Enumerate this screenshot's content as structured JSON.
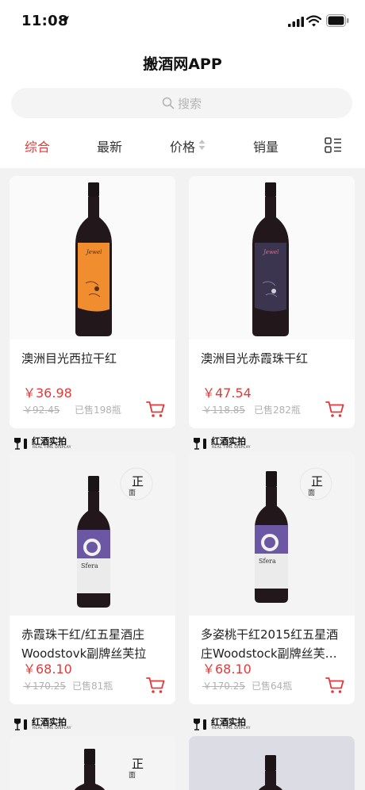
{
  "status": {
    "time": "11:08"
  },
  "header": {
    "title": "搬酒网APP"
  },
  "search": {
    "placeholder": "搜索"
  },
  "sort_tabs": [
    "综合",
    "最新",
    "价格",
    "销量"
  ],
  "products": [
    {
      "name": "澳洲目光西拉干红",
      "price": "￥36.98",
      "original_price": "￥92.45",
      "sold": "已售198瓶",
      "label_color": "#ef8d2f"
    },
    {
      "name": "澳洲目光赤霞珠干红",
      "price": "￥47.54",
      "original_price": "￥118.85",
      "sold": "已售282瓶",
      "label_color": "#3c3550"
    },
    {
      "name": "赤霞珠干红/红五星酒庄Woodstovk副牌丝芙拉赤…",
      "price": "￥68.10",
      "original_price": "￥170.25",
      "sold": "已售81瓶",
      "label_color": "#6b57a3"
    },
    {
      "name": "多姿桃干红2015红五星酒庄Woodstock副牌丝芙…",
      "price": "￥68.10",
      "original_price": "￥170.25",
      "sold": "已售64瓶",
      "label_color": "#6b57a3"
    }
  ],
  "badge": {
    "label": "红酒实拍",
    "sub": "REAL TIME DISPLAY"
  },
  "authentic": {
    "big": "正",
    "small": "面"
  },
  "sfera_label": "Sfera",
  "colors": {
    "accent": "#e23a3a",
    "bg": "#f2f2f2"
  }
}
